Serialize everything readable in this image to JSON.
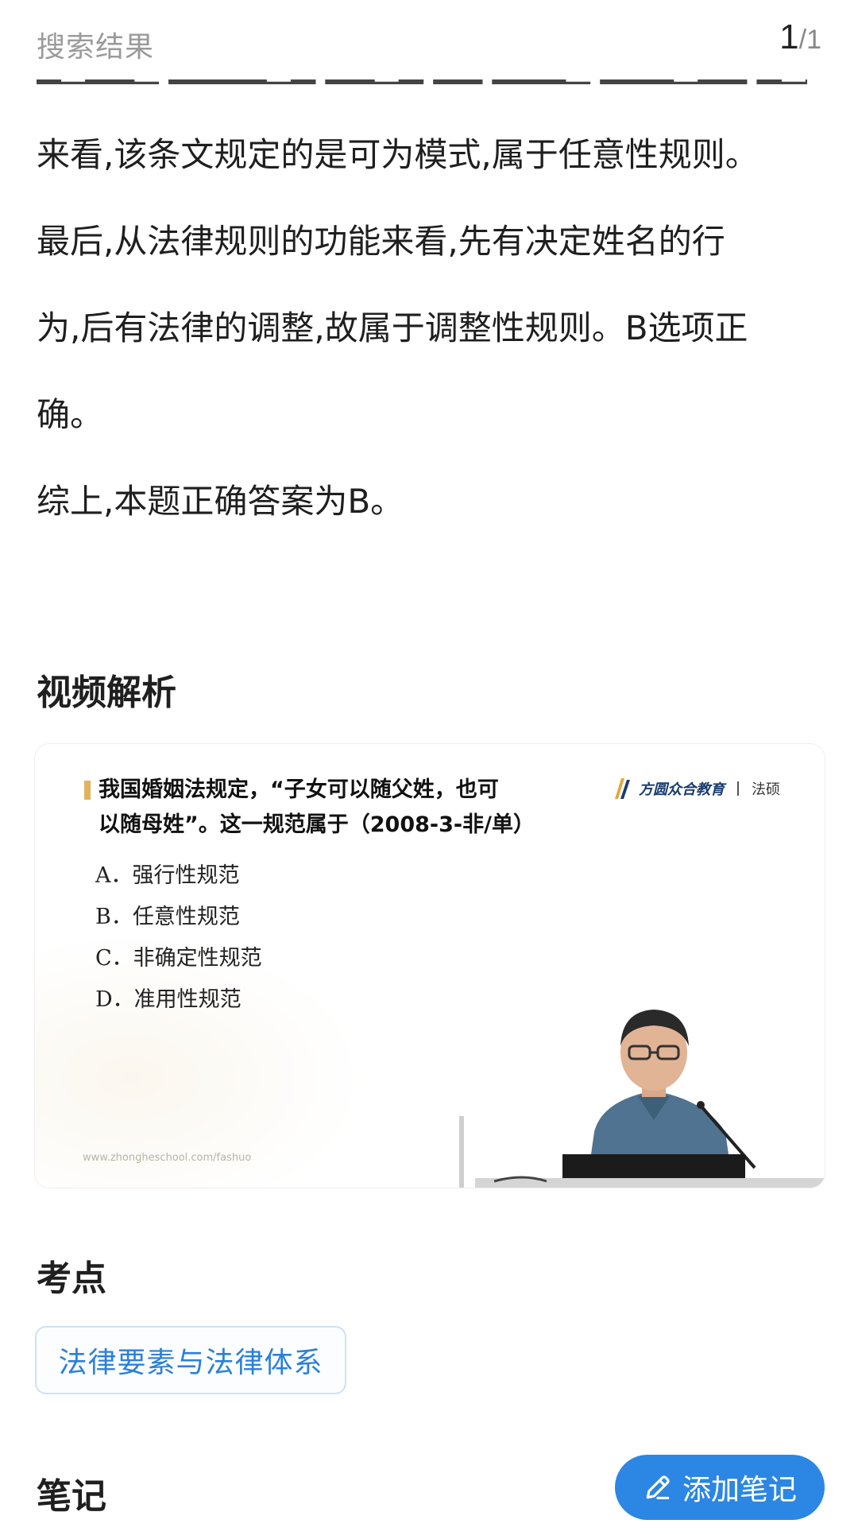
{
  "header": {
    "title": "搜索结果",
    "page_current": "1",
    "page_sep": "/",
    "page_total": "1"
  },
  "analysis": {
    "lines": [
      "来看,该条文规定的是可为模式,属于任意性规则。",
      "最后,从法律规则的功能来看,先有决定姓名的行",
      "为,后有法律的调整,故属于调整性规则。B选项正",
      "确。",
      "综上,本题正确答案为B。"
    ]
  },
  "video_section": {
    "title": "视频解析",
    "slide": {
      "question_line1": "我国婚姻法规定，“子女可以随父姓，也可",
      "question_line2": "以随母姓”。这一规范属于（2008-3-非/单）",
      "options": [
        "A．强行性规范",
        "B．任意性规范",
        "C．非确定性规范",
        "D．准用性规范"
      ],
      "logo_name": "方圆众合教育",
      "logo_sub": "法硕",
      "url": "www.zhongheschool.com/fashuo"
    }
  },
  "exam_point": {
    "title": "考点",
    "tag": "法律要素与法律体系"
  },
  "notes": {
    "title": "笔记",
    "add_label": "添加笔记"
  },
  "colors": {
    "accent": "#2b87e3",
    "tag_text": "#2b80d9",
    "tag_border": "#cfe1f2",
    "header_text": "#9a9a9a"
  }
}
